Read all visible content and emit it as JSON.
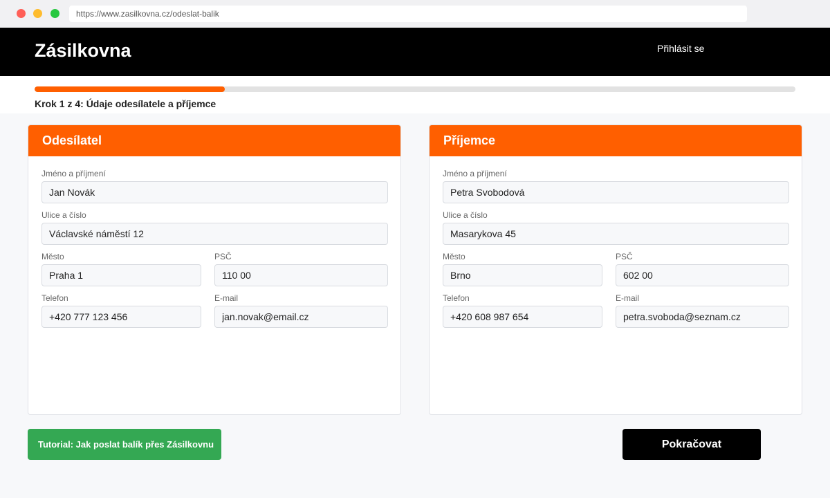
{
  "browser": {
    "url": "https://www.zasilkovna.cz/odeslat-balik"
  },
  "header": {
    "brand": "Zásilkovna",
    "login_label": "Přihlásit se"
  },
  "progress": {
    "fraction": 0.25,
    "step_label": "Krok 1 z 4: Údaje odesílatele a příjemce"
  },
  "sender": {
    "title": "Odesílatel",
    "name": {
      "label": "Jméno a příjmení",
      "value": "Jan Novák"
    },
    "street": {
      "label": "Ulice a číslo",
      "value": "Václavské náměstí 12"
    },
    "city": {
      "label": "Město",
      "value": "Praha 1"
    },
    "zip": {
      "label": "PSČ",
      "value": "110 00"
    },
    "phone": {
      "label": "Telefon",
      "value": "+420 777 123 456"
    },
    "email": {
      "label": "E-mail",
      "value": "jan.novak@email.cz"
    }
  },
  "recipient": {
    "title": "Příjemce",
    "name": {
      "label": "Jméno a příjmení",
      "value": "Petra Svobodová"
    },
    "street": {
      "label": "Ulice a číslo",
      "value": "Masarykova 45"
    },
    "city": {
      "label": "Město",
      "value": "Brno"
    },
    "zip": {
      "label": "PSČ",
      "value": "602 00"
    },
    "phone": {
      "label": "Telefon",
      "value": "+420 608 987 654"
    },
    "email": {
      "label": "E-mail",
      "value": "petra.svoboda@seznam.cz"
    }
  },
  "actions": {
    "tutorial_label": "Tutorial: Jak poslat balík přes Zásilkovnu",
    "continue_label": "Pokračovat"
  },
  "colors": {
    "accent": "#ff5f00",
    "header_bg": "#000000",
    "tutorial_bg": "#34a853"
  }
}
